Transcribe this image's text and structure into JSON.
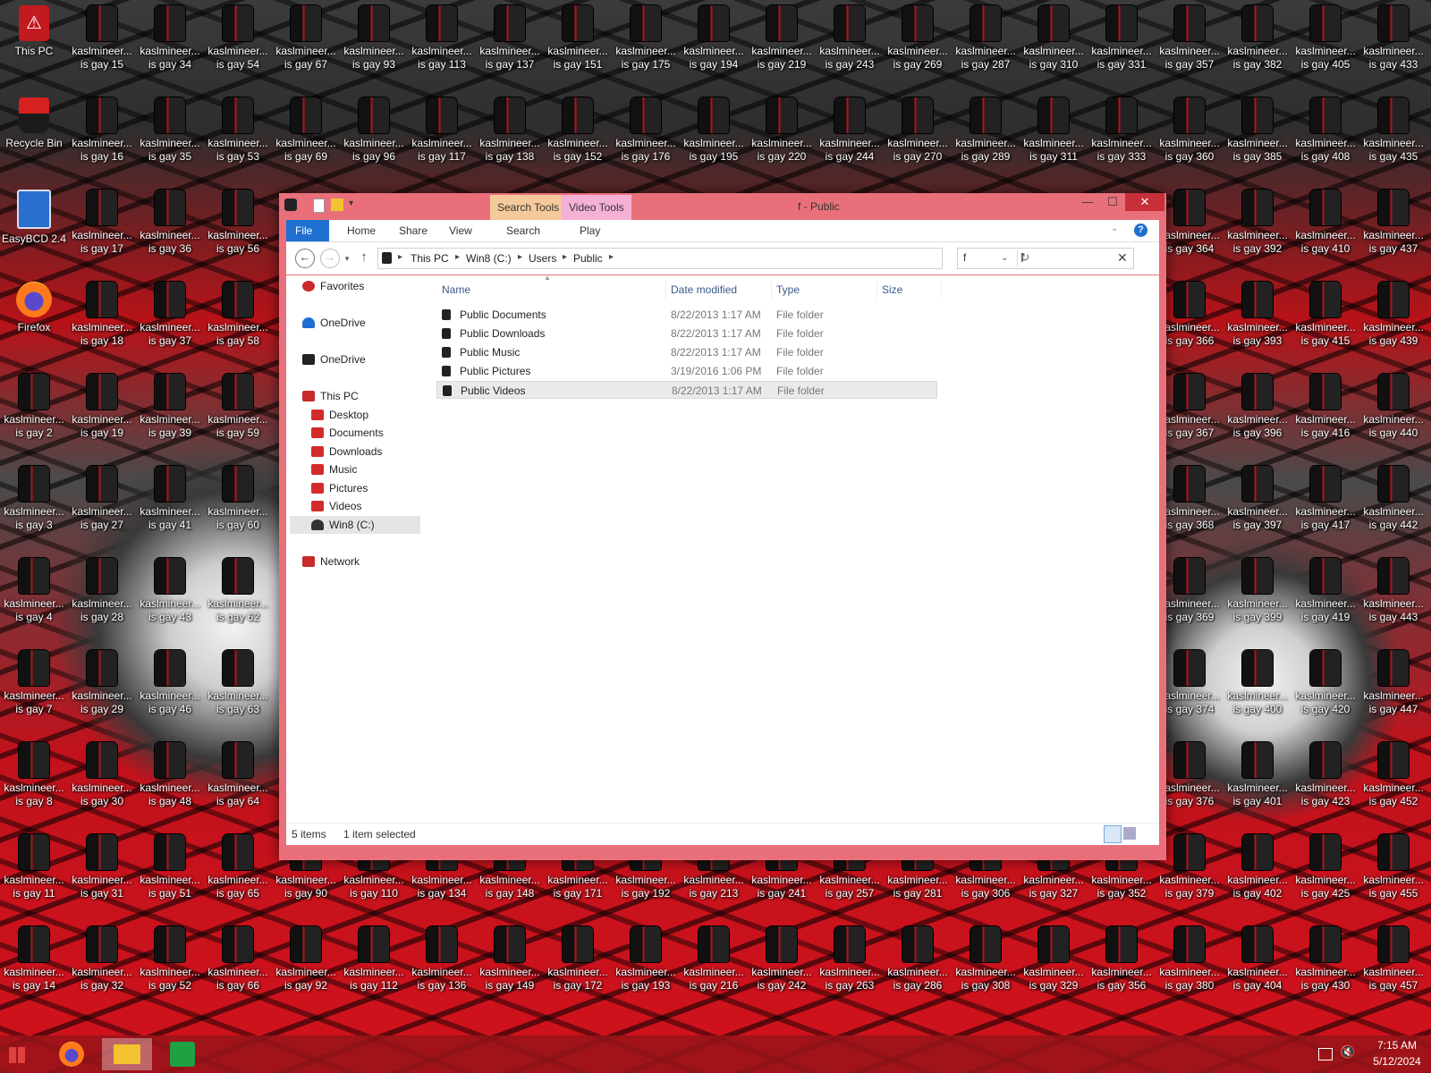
{
  "desktop": {
    "labels": {
      "this_pc": "This PC",
      "recycle_bin": "Recycle Bin",
      "easybcd": "EasyBCD 2.4",
      "firefox": "Firefox",
      "shortcut_line1": "kaslmineer..."
    },
    "columns": [
      {
        "col": 0,
        "items": [
          "",
          "",
          "",
          "",
          "is gay 2",
          "is gay 3",
          "is gay 4",
          "is gay 7",
          "is gay 8",
          "is gay 11",
          "is gay 14"
        ]
      },
      {
        "col": 1,
        "items": [
          "is gay 15",
          "is gay 16",
          "is gay 17",
          "is gay 18",
          "is gay 19",
          "is gay 27",
          "is gay 28",
          "is gay 29",
          "is gay 30",
          "is gay 31",
          "is gay 32"
        ]
      },
      {
        "col": 2,
        "items": [
          "is gay 34",
          "is gay 35",
          "is gay 36",
          "is gay 37",
          "is gay 39",
          "is gay 41",
          "is gay 43",
          "is gay 46",
          "is gay 48",
          "is gay 51",
          "is gay 52"
        ]
      },
      {
        "col": 3,
        "items": [
          "is gay 54",
          "is gay 53",
          "is gay 56",
          "is gay 58",
          "is gay 59",
          "is gay 60",
          "is gay 62",
          "is gay 63",
          "is gay 64",
          "is gay 65",
          "is gay 66"
        ]
      },
      {
        "col": 4,
        "items": [
          "is gay 67",
          "is gay 69",
          "",
          "",
          "",
          "",
          "",
          "",
          "",
          "is gay 90",
          "is gay 92"
        ]
      },
      {
        "col": 5,
        "items": [
          "is gay 93",
          "is gay 96",
          "",
          "",
          "",
          "",
          "",
          "",
          "",
          "is gay 110",
          "is gay 112"
        ]
      },
      {
        "col": 6,
        "items": [
          "is gay 113",
          "is gay 117",
          "",
          "",
          "",
          "",
          "",
          "",
          "",
          "is gay 134",
          "is gay 136"
        ]
      },
      {
        "col": 7,
        "items": [
          "is gay 137",
          "is gay 138",
          "",
          "",
          "",
          "",
          "",
          "",
          "",
          "is gay 148",
          "is gay 149"
        ]
      },
      {
        "col": 8,
        "items": [
          "is gay 151",
          "is gay 152",
          "",
          "",
          "",
          "",
          "",
          "",
          "",
          "is gay 171",
          "is gay 172"
        ]
      },
      {
        "col": 9,
        "items": [
          "is gay 175",
          "is gay 176",
          "",
          "",
          "",
          "",
          "",
          "",
          "",
          "is gay 192",
          "is gay 193"
        ]
      },
      {
        "col": 10,
        "items": [
          "is gay 194",
          "is gay 195",
          "",
          "",
          "",
          "",
          "",
          "",
          "",
          "is gay 213",
          "is gay 216"
        ]
      },
      {
        "col": 11,
        "items": [
          "is gay 219",
          "is gay 220",
          "",
          "",
          "",
          "",
          "",
          "",
          "",
          "is gay 241",
          "is gay 242"
        ]
      },
      {
        "col": 12,
        "items": [
          "is gay 243",
          "is gay 244",
          "",
          "",
          "",
          "",
          "",
          "",
          "",
          "is gay 257",
          "is gay 263"
        ]
      },
      {
        "col": 13,
        "items": [
          "is gay 269",
          "is gay 270",
          "",
          "",
          "",
          "",
          "",
          "",
          "",
          "is gay 281",
          "is gay 286"
        ]
      },
      {
        "col": 14,
        "items": [
          "is gay 287",
          "is gay 289",
          "",
          "",
          "",
          "",
          "",
          "",
          "",
          "is gay 306",
          "is gay 308"
        ]
      },
      {
        "col": 15,
        "items": [
          "is gay 310",
          "is gay 311",
          "",
          "",
          "",
          "",
          "",
          "",
          "",
          "is gay 327",
          "is gay 329"
        ]
      },
      {
        "col": 16,
        "items": [
          "is gay 331",
          "is gay 333",
          "",
          "",
          "",
          "",
          "",
          "",
          "",
          "is gay 352",
          "is gay 356"
        ]
      },
      {
        "col": 17,
        "items": [
          "is gay 357",
          "is gay 360",
          "is gay 364",
          "is gay 366",
          "is gay 367",
          "is gay 368",
          "is gay 369",
          "is gay 374",
          "is gay 376",
          "is gay 379",
          "is gay 380"
        ]
      },
      {
        "col": 18,
        "items": [
          "is gay 382",
          "is gay 385",
          "is gay 392",
          "is gay 393",
          "is gay 396",
          "is gay 397",
          "is gay 399",
          "is gay 400",
          "is gay 401",
          "is gay 402",
          "is gay 404"
        ]
      },
      {
        "col": 19,
        "items": [
          "is gay 405",
          "is gay 408",
          "is gay 410",
          "is gay 415",
          "is gay 416",
          "is gay 417",
          "is gay 419",
          "is gay 420",
          "is gay 423",
          "is gay 425",
          "is gay 430"
        ]
      },
      {
        "col": 20,
        "items": [
          "is gay 433",
          "is gay 435",
          "is gay 437",
          "is gay 439",
          "is gay 440",
          "is gay 442",
          "is gay 443",
          "is gay 447",
          "is gay 452",
          "is gay 455",
          "is gay 457"
        ]
      }
    ]
  },
  "explorer": {
    "title": "f - Public",
    "context_tabs": {
      "search_tools": "Search Tools",
      "video_tools": "Video Tools"
    },
    "ribbon_tabs": {
      "file": "File",
      "home": "Home",
      "share": "Share",
      "view": "View",
      "search": "Search",
      "play": "Play"
    },
    "help_label": "?",
    "address": {
      "this_pc": "This PC",
      "drive": "Win8 (C:)",
      "users": "Users",
      "public": "Public"
    },
    "search_value": "f",
    "columns": {
      "name": "Name",
      "date": "Date modified",
      "type": "Type",
      "size": "Size"
    },
    "files": [
      {
        "name": "Public Documents",
        "date": "8/22/2013 1:17 AM",
        "type": "File folder"
      },
      {
        "name": "Public Downloads",
        "date": "8/22/2013 1:17 AM",
        "type": "File folder"
      },
      {
        "name": "Public Music",
        "date": "8/22/2013 1:17 AM",
        "type": "File folder"
      },
      {
        "name": "Public Pictures",
        "date": "3/19/2016 1:06 PM",
        "type": "File folder"
      },
      {
        "name": "Public Videos",
        "date": "8/22/2013 1:17 AM",
        "type": "File folder"
      }
    ],
    "selected_index": 4,
    "nav": {
      "favorites": "Favorites",
      "onedrive_1": "OneDrive",
      "onedrive_2": "OneDrive",
      "this_pc": "This PC",
      "desktop": "Desktop",
      "documents": "Documents",
      "downloads": "Downloads",
      "music": "Music",
      "pictures": "Pictures",
      "videos": "Videos",
      "drive": "Win8 (C:)",
      "network": "Network"
    },
    "status": {
      "count": "5 items",
      "selected": "1 item selected"
    }
  },
  "taskbar": {
    "time": "7:15 AM",
    "date": "5/12/2024"
  },
  "colors": {
    "accent": "#1e6fd0",
    "window_border": "#e9707a",
    "taskbar": "#96141a"
  }
}
